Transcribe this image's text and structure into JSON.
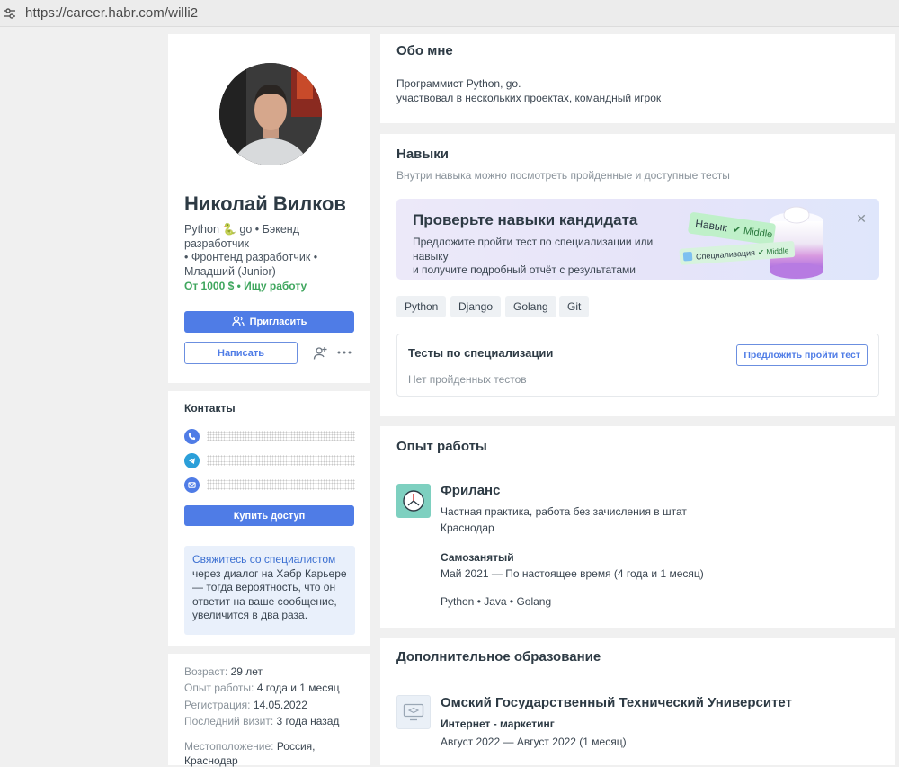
{
  "browser": {
    "url": "https://career.habr.com/willi2"
  },
  "profile": {
    "name": "Николай Вилков",
    "spec_line1": "Python 🐍 go • Бэкенд разработчик",
    "spec_line2": "• Фронтенд разработчик •",
    "spec_line3": "Младший (Junior)",
    "salary": "От 1000 $ • Ищу работу",
    "invite_label": "Пригласить",
    "write_label": "Написать"
  },
  "contacts": {
    "title": "Контакты",
    "buy_label": "Купить доступ",
    "hint_link": "Свяжитесь со специалистом",
    "hint_text": "через диалог на Хабр Карьере — тогда вероятность, что он ответит на ваше сообщение, увеличится в два раза."
  },
  "meta": {
    "age_label": "Возраст:",
    "age": "29 лет",
    "exp_label": "Опыт работы:",
    "exp": "4 года и 1 месяц",
    "reg_label": "Регистрация:",
    "reg": "14.05.2022",
    "visit_label": "Последний визит:",
    "visit": "3 года назад",
    "loc_label": "Местоположение:",
    "loc1": "Россия,",
    "loc2": "Краснодар"
  },
  "about": {
    "title": "Обо мне",
    "line1": "Программист Python, go.",
    "line2": "участвовал в нескольких проектах, командный игрок"
  },
  "skills": {
    "title": "Навыки",
    "subtitle": "Внутри навыка можно посмотреть пройденные и доступные тесты",
    "banner_title": "Проверьте навыки кандидата",
    "banner_line1": "Предложите пройти тест по специализации или навыку",
    "banner_line2": "и получите подробный отчёт с результатами",
    "chip1_label": "Навык",
    "chip1_level": "✔ Middle",
    "chip2_label": "Специализация",
    "chip2_level": "✔ Middle",
    "tags": [
      "Python",
      "Django",
      "Golang",
      "Git"
    ],
    "tests_title": "Тесты по специализации",
    "tests_empty": "Нет пройденных тестов",
    "offer_label": "Предложить пройти тест"
  },
  "experience": {
    "title": "Опыт работы",
    "company": "Фриланс",
    "company_desc": "Частная практика, работа без зачисления в штат",
    "city": "Краснодар",
    "position": "Самозанятый",
    "period": "Май 2021 — По настоящее время (4 года и 1 месяц)",
    "skills": "Python • Java • Golang"
  },
  "education": {
    "title": "Дополнительное образование",
    "university": "Омский Государственный Технический Университет",
    "course": "Интернет - маркетинг",
    "period": "Август 2022 — Август 2022 (1 месяц)"
  }
}
